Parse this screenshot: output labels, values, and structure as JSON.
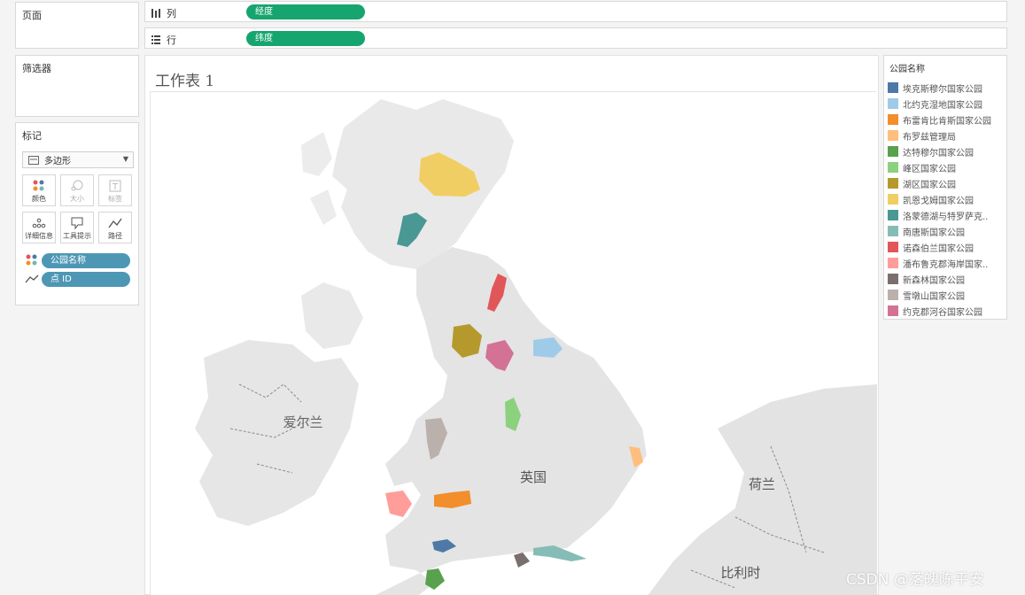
{
  "pages": {
    "title": "页面"
  },
  "filters": {
    "title": "筛选器"
  },
  "marks": {
    "title": "标记",
    "mark_type": "多边形",
    "buttons": [
      {
        "label": "颜色",
        "icon": "color-icon"
      },
      {
        "label": "大小",
        "icon": "size-icon"
      },
      {
        "label": "标签",
        "icon": "label-icon"
      },
      {
        "label": "详细信息",
        "icon": "detail-icon"
      },
      {
        "label": "工具提示",
        "icon": "tooltip-icon"
      },
      {
        "label": "路径",
        "icon": "path-icon"
      }
    ],
    "pills": [
      {
        "label": "公园名称",
        "icon": "color-icon"
      },
      {
        "label": "点 ID",
        "icon": "path-icon"
      }
    ]
  },
  "shelves": {
    "columns": {
      "label": "列",
      "pill": "经度"
    },
    "rows": {
      "label": "行",
      "pill": "纬度"
    }
  },
  "worksheet": {
    "title": "工作表 1",
    "map_labels": {
      "ireland": "爱尔兰",
      "uk": "英国",
      "netherlands": "荷兰",
      "belgium": "比利时"
    }
  },
  "legend": {
    "title": "公园名称",
    "items": [
      {
        "label": "埃克斯穆尔国家公园",
        "color": "#4e79a7"
      },
      {
        "label": "北约克湿地国家公园",
        "color": "#a0cbe8"
      },
      {
        "label": "布雷肯比肯斯国家公园",
        "color": "#f28e2b"
      },
      {
        "label": "布罗兹管理局",
        "color": "#ffbe7d"
      },
      {
        "label": "达特穆尔国家公园",
        "color": "#59a14f"
      },
      {
        "label": "峰区国家公园",
        "color": "#8cd17d"
      },
      {
        "label": "湖区国家公园",
        "color": "#b6992d"
      },
      {
        "label": "凯恩戈姆国家公园",
        "color": "#f1ce63"
      },
      {
        "label": "洛蒙德湖与特罗萨克..",
        "color": "#499894"
      },
      {
        "label": "南唐斯国家公园",
        "color": "#86bcb6"
      },
      {
        "label": "诺森伯兰国家公园",
        "color": "#e15759"
      },
      {
        "label": "潘布鲁克郡海岸国家..",
        "color": "#ff9d9a"
      },
      {
        "label": "新森林国家公园",
        "color": "#79706e"
      },
      {
        "label": "雪墩山国家公园",
        "color": "#bab0ac"
      },
      {
        "label": "约克郡河谷国家公园",
        "color": "#d37295"
      }
    ]
  },
  "watermark": "CSDN @落魄陈平安"
}
